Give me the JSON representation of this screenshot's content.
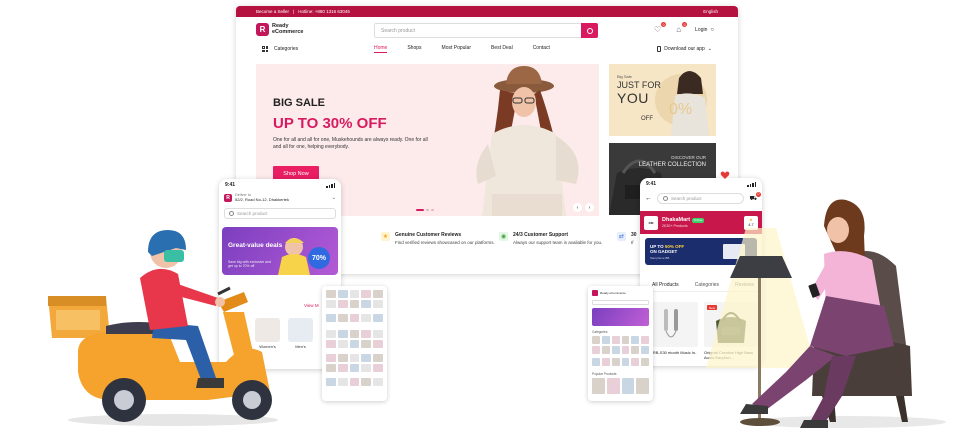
{
  "topbar": {
    "become_seller": "Become a Seller",
    "hotline": "Hotline: +880 1316 63045",
    "language": "English"
  },
  "header": {
    "logo_line1": "Ready",
    "logo_line2": "eCommerce",
    "search_placeholder": "Search product",
    "wishlist_count": "0",
    "cart_count": "0",
    "login": "Login"
  },
  "nav": {
    "categories": "Categories",
    "links": [
      "Home",
      "Shops",
      "Most Popular",
      "Best Deal",
      "Contact"
    ],
    "download": "Download our app"
  },
  "hero": {
    "title": "BIG SALE",
    "headline": "UP TO 30% OFF",
    "description": "One for all and all for one, Muskehounds are always ready. One for all and all for one, helping everybody.",
    "cta": "Shop Now"
  },
  "side_banner_1": {
    "kicker": "Big Sale",
    "line1": "JUST FOR",
    "line2": "YOU",
    "line3": "OFF"
  },
  "side_banner_2": {
    "kicker": "DISCOVER OUR",
    "line1": "LEATHER COLLECTION"
  },
  "features": [
    {
      "title": "ys",
      "desc": "your",
      "icon": ""
    },
    {
      "title": "Genuine Customer Reviews",
      "desc": "Find verified reviews showcased on our platforms.",
      "icon": "★"
    },
    {
      "title": "24/3 Customer Support",
      "desc": "Always our support team is available for you.",
      "icon": "◉"
    },
    {
      "title": "30",
      "desc": "If",
      "icon": "⇄"
    }
  ],
  "phone_left": {
    "time": "9:41",
    "deliver_label": "Deliver to",
    "address": "52/2, Road No-12, Dhakkertek",
    "search_placeholder": "Search product",
    "banner_title": "Great-value deals",
    "banner_sub": "Save big with exclusive and get up to 70% off",
    "banner_pct": "70%",
    "section_suffix": "ries",
    "view_more": "View M",
    "categories": [
      "",
      "Women's",
      "Men's"
    ]
  },
  "phone_right": {
    "time": "9:41",
    "search_placeholder": "Search product",
    "cart_count": "0",
    "shop_name": "DhakaMart",
    "shop_status": "Online",
    "shop_products": "2K30+ Products",
    "rating": "4.7",
    "promo_line1": "UP TO ",
    "promo_pct": "50% OFF",
    "promo_line2": "ON GADGET",
    "promo_brand": "Samphone BB",
    "tabs": [
      "All Products",
      "Categories",
      "Reviews"
    ],
    "products": [
      {
        "name": "mon RB-S30 etooth Music In-E...",
        "tag": ""
      },
      {
        "name": "Original Creative High Bass Audio Earphon...",
        "tag": "New"
      }
    ]
  },
  "tablet_b": {
    "logo": "Ready eCommerce",
    "categories_label": "Categories",
    "popular_label": "Popular Products"
  },
  "icons": {
    "accent": "#d81b60",
    "brand_red": "#b5123f"
  }
}
